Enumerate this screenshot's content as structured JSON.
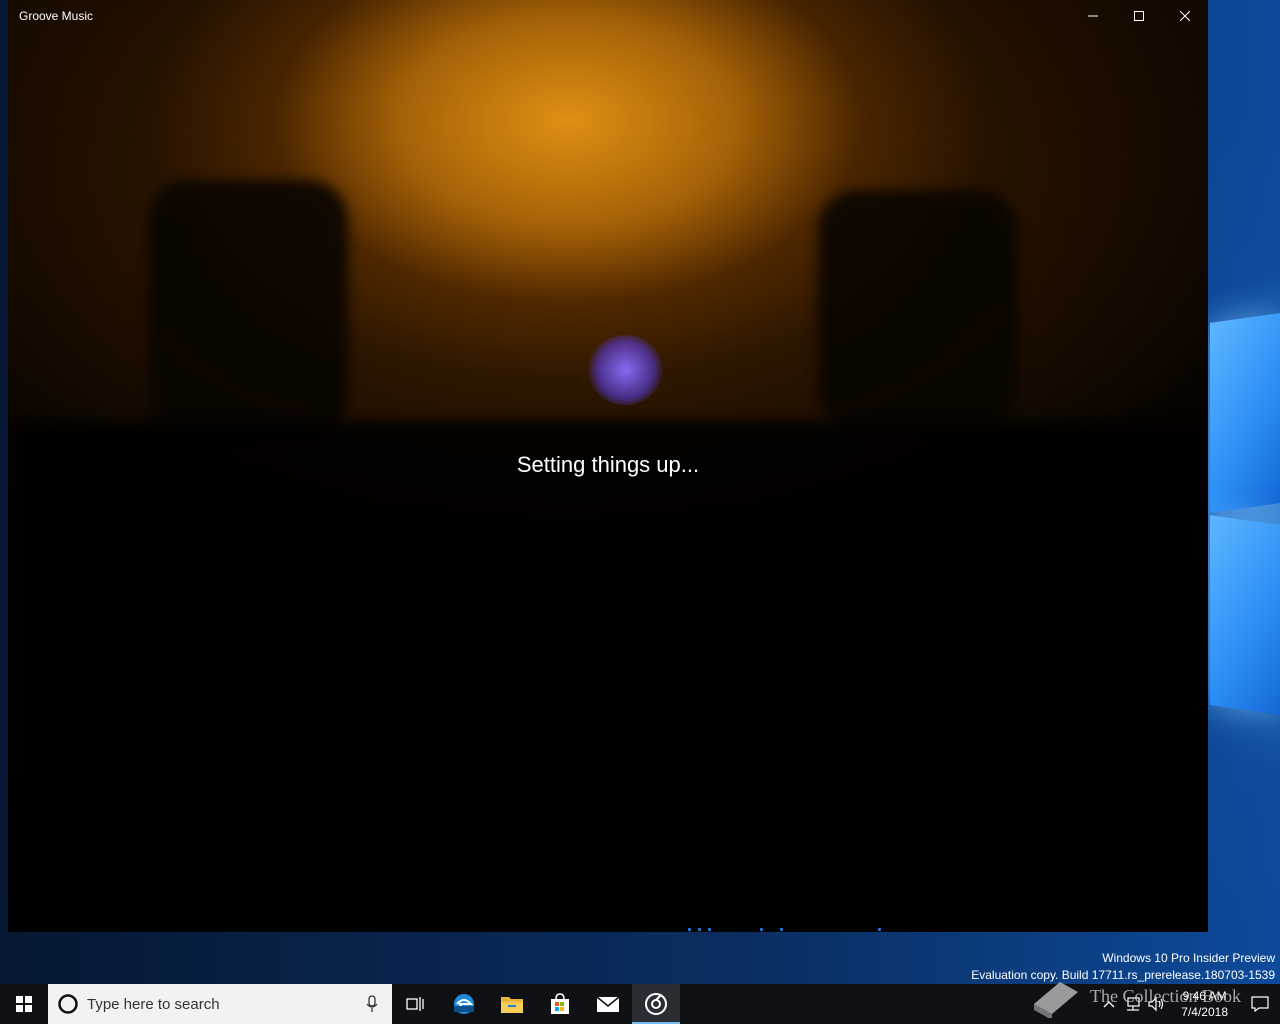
{
  "window": {
    "title": "Groove Music",
    "status_text": "Setting things up..."
  },
  "caption_buttons": {
    "minimize_icon": "minimize-icon",
    "maximize_icon": "maximize-icon",
    "close_icon": "close-icon"
  },
  "watermark": {
    "line1": "Windows 10 Pro Insider Preview",
    "line2": "Evaluation copy. Build 17711.rs_prerelease.180703-1539"
  },
  "taskbar": {
    "search_placeholder": "Type here to search",
    "pinned_icons": [
      "windows-start-icon",
      "cortana-circle-icon",
      "microphone-icon",
      "task-view-icon",
      "edge-beta-icon",
      "file-explorer-icon",
      "store-icon",
      "mail-icon",
      "groove-music-icon"
    ],
    "active_app": "groove-music-icon"
  },
  "tray": {
    "time": "9:46 AM",
    "date": "7/4/2018",
    "icons": [
      "chevron-up-icon",
      "network-icon",
      "volume-icon",
      "action-center-icon"
    ]
  },
  "overlay_logo_text": "The Collection Book",
  "colors": {
    "accent": "#1e7fe0",
    "taskbar": "#0f1114",
    "hero_glow": "#e69614"
  }
}
